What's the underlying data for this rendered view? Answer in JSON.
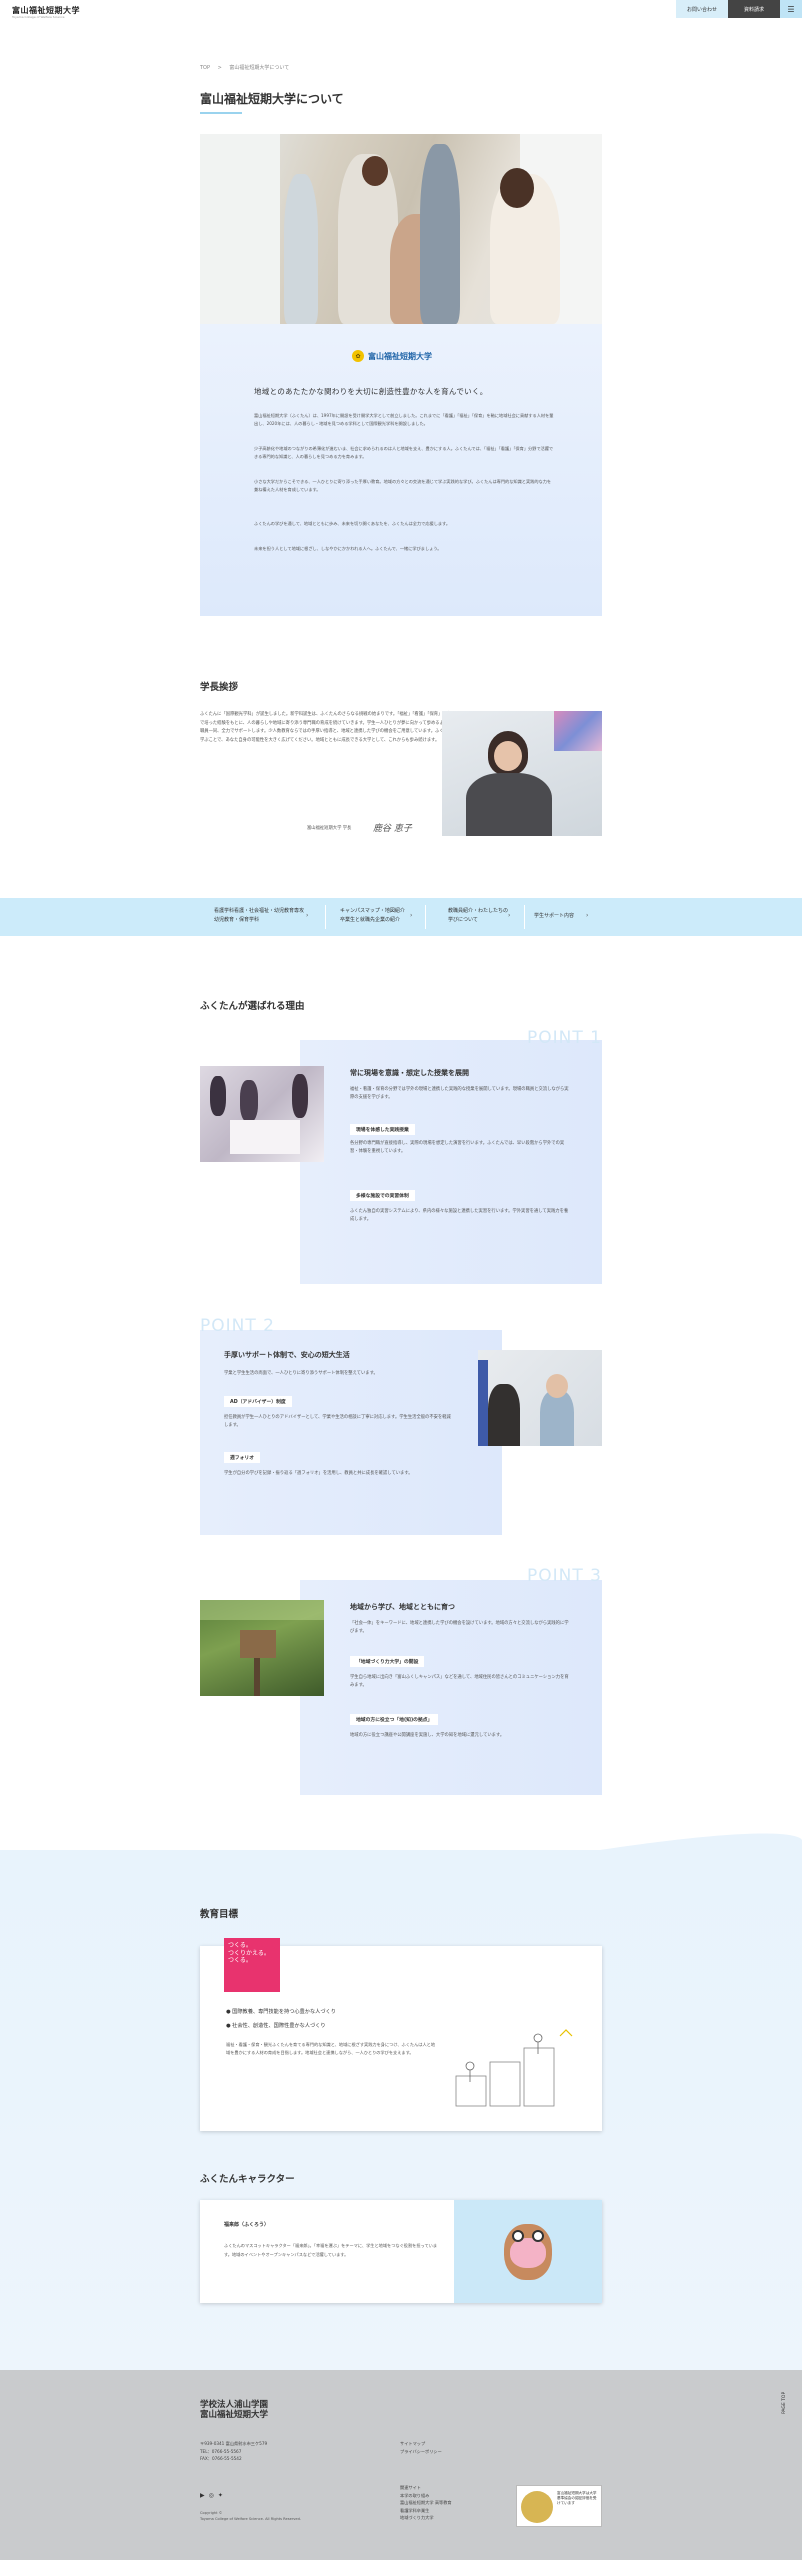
{
  "header": {
    "logo": "富山福祉短期大学",
    "logo_sub": "Toyama College of Welfare Science",
    "contact": "お問い合わせ",
    "request": "資料請求",
    "menu_icon": "☰"
  },
  "breadcrumb": {
    "home": "TOP",
    "separator": ">",
    "current": "富山福祉短期大学について"
  },
  "page_title": "富山福祉短期大学について",
  "intro": {
    "logo_text": "富山福祉短期大学",
    "catch": "地域とのあたたかな関わりを大切に創造性豊かな人を育んでいく。",
    "p1": "富山福祉短期大学（ふくたん）は、1997年に開設を受け開学大学として創立しました。これまでに「看護」「福祉」「保育」を軸に地域社会に貢献する人材を輩出し、2020年には、人の暮らし・地域を見つめる学科として国際観光学科を開設しました。",
    "p2": "少子高齢化や地域のつながりの希薄化が進むいま、社会に求められるのは人と地域を支え、豊かにする人。ふくたんでは、「福祉」「看護」「保育」分野で活躍できる専門的な知識と、人の暮らしを見つめる力を育みます。",
    "p3": "小さな大学だからこそできる、一人ひとりに寄り添った手厚い教育。地域の方々との交流を通じて学ぶ実践的な学び。ふくたんは専門的な知識と実践的な力を兼ね備えた人材を育成しています。",
    "p4": "ふくたんの学びを通して、地域とともに歩み、未来を切り開くあなたを、ふくたんは全力で応援します。",
    "p5": "未来を担う人として地域に根ざし、しなやかにかかわれる人へ。ふくたんで、一緒に学びましょう。"
  },
  "president": {
    "heading": "学長挨拶",
    "body": "ふくたんに「国際観光学科」が誕生しました。新学科誕生は、ふくたんのさらなる挑戦の始まりです。「福祉」「看護」「保育」の各分野で培った経験をもとに、人の暮らしや地域に寄り添う専門職の育成を続けていきます。学生一人ひとりが夢に向かって歩めるよう、教職員一同、全力でサポートします。少人数教育ならではの手厚い指導と、地域と連携した学びの機会をご用意しています。ふくたんで学ぶことで、あなた自身の可能性を大きく広げてください。地域とともに成長できる大学として、これからも歩み続けます。",
    "name": "富山福祉短期大学 学長",
    "signature": "鹿谷 恵子"
  },
  "nav": [
    {
      "line1": "看護学科看護・社会福祉・幼児教育専攻",
      "line2": "幼児教育・保育学科"
    },
    {
      "line1": "キャンパスマップ・地図紹介",
      "line2": "卒業生と就職先企業の紹介"
    },
    {
      "line1": "教職員紹介・わたしたちの",
      "line2": "学びについて"
    },
    {
      "line1": "学生サポート内容",
      "line2": ""
    }
  ],
  "nav_arrow": "›",
  "why": {
    "heading": "ふくたんが選ばれる理由"
  },
  "points": [
    {
      "num": "POINT 1",
      "title": "常に現場を意識・想定した授業を展開",
      "body": "福祉・看護・保育の分野では学外の現場と連携した実践的な授業を展開しています。現場の職員と交流しながら実際の支援を学びます。",
      "tag1": "現場を体感した実践授業",
      "text1": "各分野の専門職が直接指導し、実際の現場を想定した演習を行います。ふくたんでは、早い段階から学外での実習・体験を重視しています。",
      "tag2": "多様な施設での実習体制",
      "text2": "ふくたん独自の実習システムにより、県内の様々な施設と連携した実習を行います。学外実習を通して実践力を養成します。"
    },
    {
      "num": "POINT 2",
      "title": "手厚いサポート体制で、安心の短大生活",
      "body": "学業と学生生活の両面で、一人ひとりに寄り添うサポート体制を整えています。",
      "tag1": "AD（アドバイザー）制度",
      "text1": "担任教員が学生一人ひとりのアドバイザーとして、学業や生活の相談に丁寧に対応します。学生生活全般の不安を軽減します。",
      "tag2": "週フォリオ",
      "text2": "学生が自分の学びを記録・振り返る「週フォリオ」を活用し、教員と共に成長を確認しています。"
    },
    {
      "num": "POINT 3",
      "title": "地域から学び、地域とともに育つ",
      "body": "「社会一体」をキーワードに、地域と連携した学びの機会を設けています。地域の方々と交流しながら実践的に学びます。",
      "tag1": "「地域づくり力大学」の開設",
      "text1": "学生自ら地域に出向き「富山ふくしキャンパス」などを通して、地域住民の皆さんとのコミュニケーション力を育みます。",
      "tag2": "地域の方に役立つ「地(知)の拠点」",
      "text2": "地域の方に役立つ講座や公開講座を実施し、大学の知を地域に還元しています。"
    }
  ],
  "goals": {
    "heading": "教育目標",
    "badge": "つくる。\nつくりかえる。\nつくる。",
    "bullet1": "● 国際教養、専門技能を持つ心豊かな人づくり",
    "bullet2": "● 社会性、創造性、国際性豊かな人づくり",
    "para": "福祉・看護・保育・観光ふくたんを育てる専門的な知識と、地域に根ざす実践力を身につけ、ふくたんは人と地域を豊かにする人材の育成を目指します。地域社会と連携しながら、一人ひとりの学びを支えます。"
  },
  "character": {
    "heading": "ふくたんキャラクター",
    "name": "福来郎（ふくろう）",
    "text": "ふくたんのマスコットキャラクター「福来郎」。「幸福を運ぶ」をテーマに、学生と地域をつなぐ役割を担っています。地域のイベントやオープンキャンパスなどで活躍しています。"
  },
  "footer": {
    "name1": "学校法人浦山学園",
    "name2": "富山福祉短期大学",
    "addr1": "〒939-0341 富山県射水市三ケ579",
    "addr2": "TEL：0766-55-5567",
    "addr3": "FAX：0766-55-5542",
    "link1": "サイトマップ",
    "link2": "プライバシーポリシー",
    "link3": "関連サイト",
    "link4": "本学の取り組み",
    "link5": "富山福祉短期大学 高等教育",
    "link6": "看護学科卒業生",
    "link7": "地域づくり力大学",
    "copy1": "Copyright ©",
    "copy2": "Toyama College of Welfare Science. All Rights Reserved.",
    "badge_text": "富山福祉短期大学は大学基準協会の認証評価を受けています",
    "page_top": "PAGE TOP"
  },
  "colors": {
    "accent": "#9ad3ee",
    "band": "#ccebfa",
    "pink": "#e8336e",
    "point": "#d3e8f7"
  }
}
